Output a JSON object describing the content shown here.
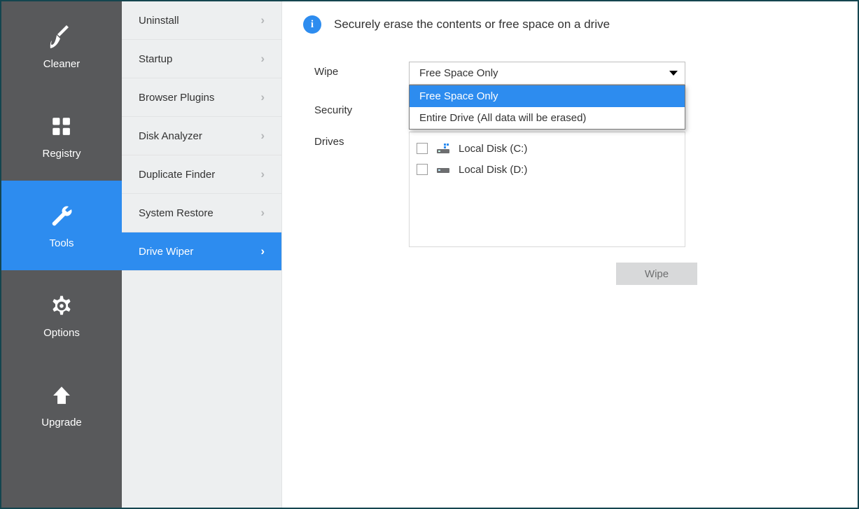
{
  "sidebar": {
    "items": [
      {
        "id": "cleaner",
        "label": "Cleaner",
        "selected": false
      },
      {
        "id": "registry",
        "label": "Registry",
        "selected": false
      },
      {
        "id": "tools",
        "label": "Tools",
        "selected": true
      },
      {
        "id": "options",
        "label": "Options",
        "selected": false
      },
      {
        "id": "upgrade",
        "label": "Upgrade",
        "selected": false
      }
    ]
  },
  "tools_menu": {
    "items": [
      {
        "label": "Uninstall",
        "selected": false
      },
      {
        "label": "Startup",
        "selected": false
      },
      {
        "label": "Browser Plugins",
        "selected": false
      },
      {
        "label": "Disk Analyzer",
        "selected": false
      },
      {
        "label": "Duplicate Finder",
        "selected": false
      },
      {
        "label": "System Restore",
        "selected": false
      },
      {
        "label": "Drive Wiper",
        "selected": true
      }
    ]
  },
  "panel": {
    "info_icon_text": "i",
    "header": "Securely erase the contents or free space on a drive",
    "labels": {
      "wipe": "Wipe",
      "security": "Security",
      "drives": "Drives"
    },
    "wipe_combo": {
      "value": "Free Space Only",
      "options": [
        "Free Space Only",
        "Entire Drive (All data will be erased)"
      ],
      "highlighted_index": 0,
      "open": true
    },
    "drives": [
      {
        "label": "Local Disk (C:)",
        "checked": false,
        "icon": "system-drive"
      },
      {
        "label": "Local Disk (D:)",
        "checked": false,
        "icon": "drive"
      }
    ],
    "action_button": "Wipe"
  }
}
